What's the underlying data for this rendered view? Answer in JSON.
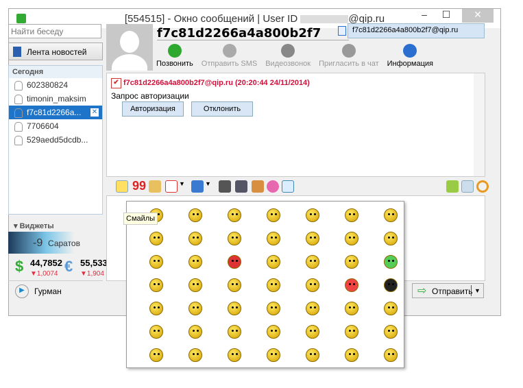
{
  "window": {
    "title_prefix": "[554515] - Окно сообщений | User ID",
    "title_suffix": "@qip.ru",
    "minimize": "‒",
    "maximize": "☐",
    "close": "✕"
  },
  "sidebar": {
    "search_placeholder": "Найти беседу",
    "news_label": "Лента новостей",
    "today_header": "Сегодня",
    "contacts": [
      {
        "name": "602380824"
      },
      {
        "name": "timonin_maksim"
      },
      {
        "name": "f7c81d2266a...",
        "selected": true
      },
      {
        "name": "7706604"
      },
      {
        "name": "529aedd5dcdb..."
      }
    ]
  },
  "widgets": {
    "header": "Виджеты",
    "weather_temp": "-9",
    "weather_city": "Саратов",
    "usd_value": "44,7852",
    "usd_change": "▼1,0074",
    "eur_value": "55,533",
    "eur_change": "▼1,904",
    "player": "Гурман"
  },
  "contact": {
    "name": "f7c81d2266a4a800b2f7",
    "id": "f7c81d2266a4a800b2f7@qip.ru"
  },
  "actions": [
    {
      "label": "Позвонить",
      "enabled": true,
      "color": "#2fa82f"
    },
    {
      "label": "Отправить SMS",
      "enabled": false,
      "color": "#aaaaaa"
    },
    {
      "label": "Видеозвонок",
      "enabled": false,
      "color": "#888888"
    },
    {
      "label": "Пригласить в чат",
      "enabled": false,
      "color": "#999999"
    },
    {
      "label": "Информация",
      "enabled": true,
      "color": "#2a6fd0"
    }
  ],
  "message": {
    "header": "f7c81d2266a4a800b2f7@qip.ru (20:20:44 24/11/2014)",
    "text": "Запрос авторизации",
    "authorize": "Авторизация",
    "decline": "Отклонить"
  },
  "tooltip": "Смайлы",
  "send_label": "Отправить",
  "smiley_count": 49
}
